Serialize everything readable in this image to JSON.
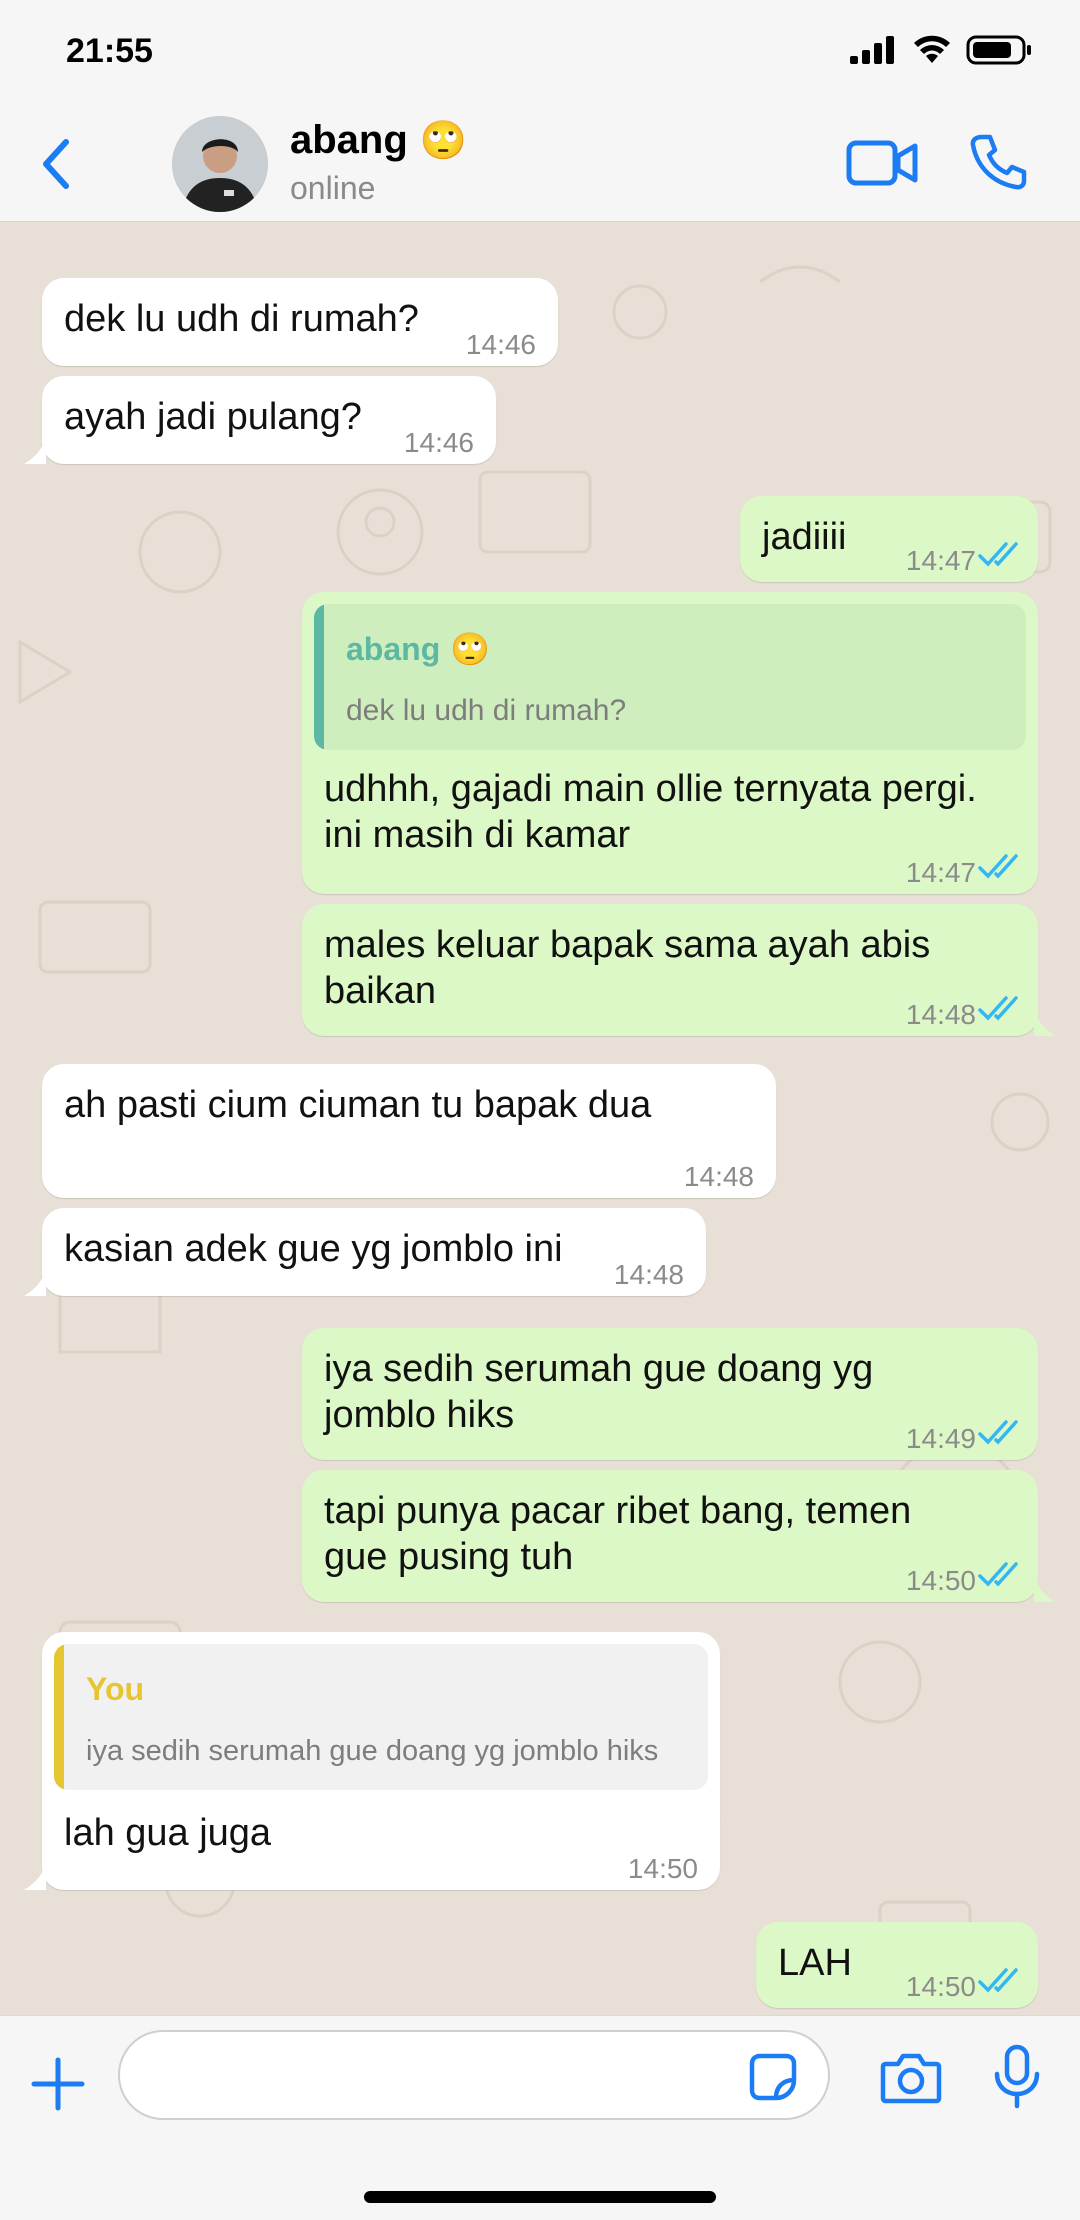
{
  "status_bar": {
    "time": "21:55"
  },
  "header": {
    "contact_name": "abang",
    "contact_emoji": "🙄",
    "contact_status": "online"
  },
  "colors": {
    "accent": "#1b7cf3",
    "outgoing_bubble": "#dcf8c6",
    "incoming_bubble": "#ffffff",
    "read_ticks": "#34b7f1",
    "quote_bar_contact": "#5cb8a3",
    "quote_bar_you": "#e5c630"
  },
  "messages": [
    {
      "direction": "in",
      "text": "dek lu udh di rumah?",
      "time": "14:46"
    },
    {
      "direction": "in",
      "text": "ayah jadi pulang?",
      "time": "14:46"
    },
    {
      "direction": "out",
      "text": "jadiiii",
      "time": "14:47",
      "status": "read"
    },
    {
      "direction": "out",
      "quote": {
        "author": "abang",
        "author_emoji": "🙄",
        "text": "dek lu udh di rumah?"
      },
      "text": "udhhh, gajadi main ollie ternyata pergi.\nini masih di kamar",
      "time": "14:47",
      "status": "read"
    },
    {
      "direction": "out",
      "text": "males keluar bapak sama ayah abis\nbaikan",
      "time": "14:48",
      "status": "read"
    },
    {
      "direction": "in",
      "text": "ah pasti cium ciuman tu bapak dua",
      "time": "14:48"
    },
    {
      "direction": "in",
      "text": "kasian adek gue yg jomblo ini",
      "time": "14:48"
    },
    {
      "direction": "out",
      "text": "iya sedih serumah gue doang yg\njomblo hiks",
      "time": "14:49",
      "status": "read"
    },
    {
      "direction": "out",
      "text": "tapi punya pacar ribet bang, temen\ngue pusing tuh",
      "time": "14:50",
      "status": "read"
    },
    {
      "direction": "in",
      "quote": {
        "author": "You",
        "text": "iya sedih serumah gue doang yg jomblo hiks"
      },
      "text": "lah gua juga",
      "time": "14:50"
    },
    {
      "direction": "out",
      "text": "LAH",
      "time": "14:50",
      "status": "read"
    }
  ],
  "input": {
    "value": "",
    "placeholder": ""
  },
  "icons": {
    "back": "chevron-left-icon",
    "video": "video-camera-icon",
    "call": "phone-icon",
    "plus": "plus-icon",
    "sticker": "sticker-icon",
    "camera": "camera-icon",
    "mic": "microphone-icon"
  }
}
